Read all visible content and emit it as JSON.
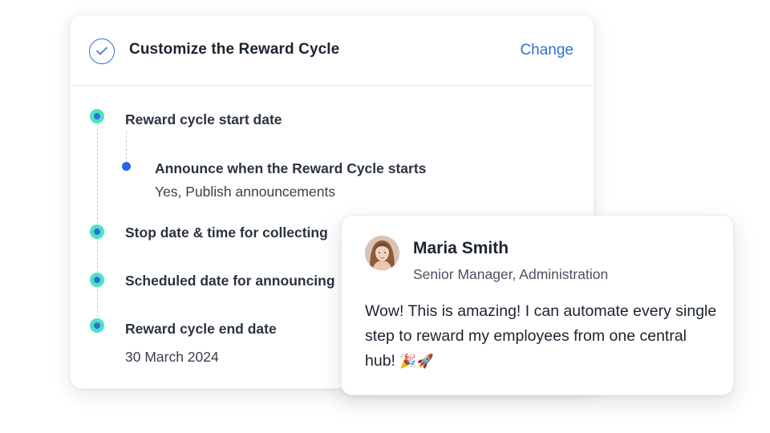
{
  "card": {
    "title": "Customize the Reward Cycle",
    "change_label": "Change",
    "steps": [
      {
        "label": "Reward cycle start date"
      },
      {
        "label": "Announce when the Reward Cycle starts",
        "value": "Yes, Publish announcements"
      },
      {
        "label": "Stop date & time for collecting"
      },
      {
        "label": "Scheduled date for announcing"
      },
      {
        "label": "Reward cycle end date",
        "value": "30 March 2024"
      }
    ]
  },
  "testimonial": {
    "name": "Maria Smith",
    "role": "Senior Manager, Administration",
    "quote": "Wow! This is amazing! I can automate every single step to reward my employees from one central hub!",
    "emojis": "🎉🚀"
  },
  "colors": {
    "accent_blue": "#2f6fd6",
    "dot_teal": "#4ce3c2",
    "sub_dot_blue": "#2563eb"
  }
}
